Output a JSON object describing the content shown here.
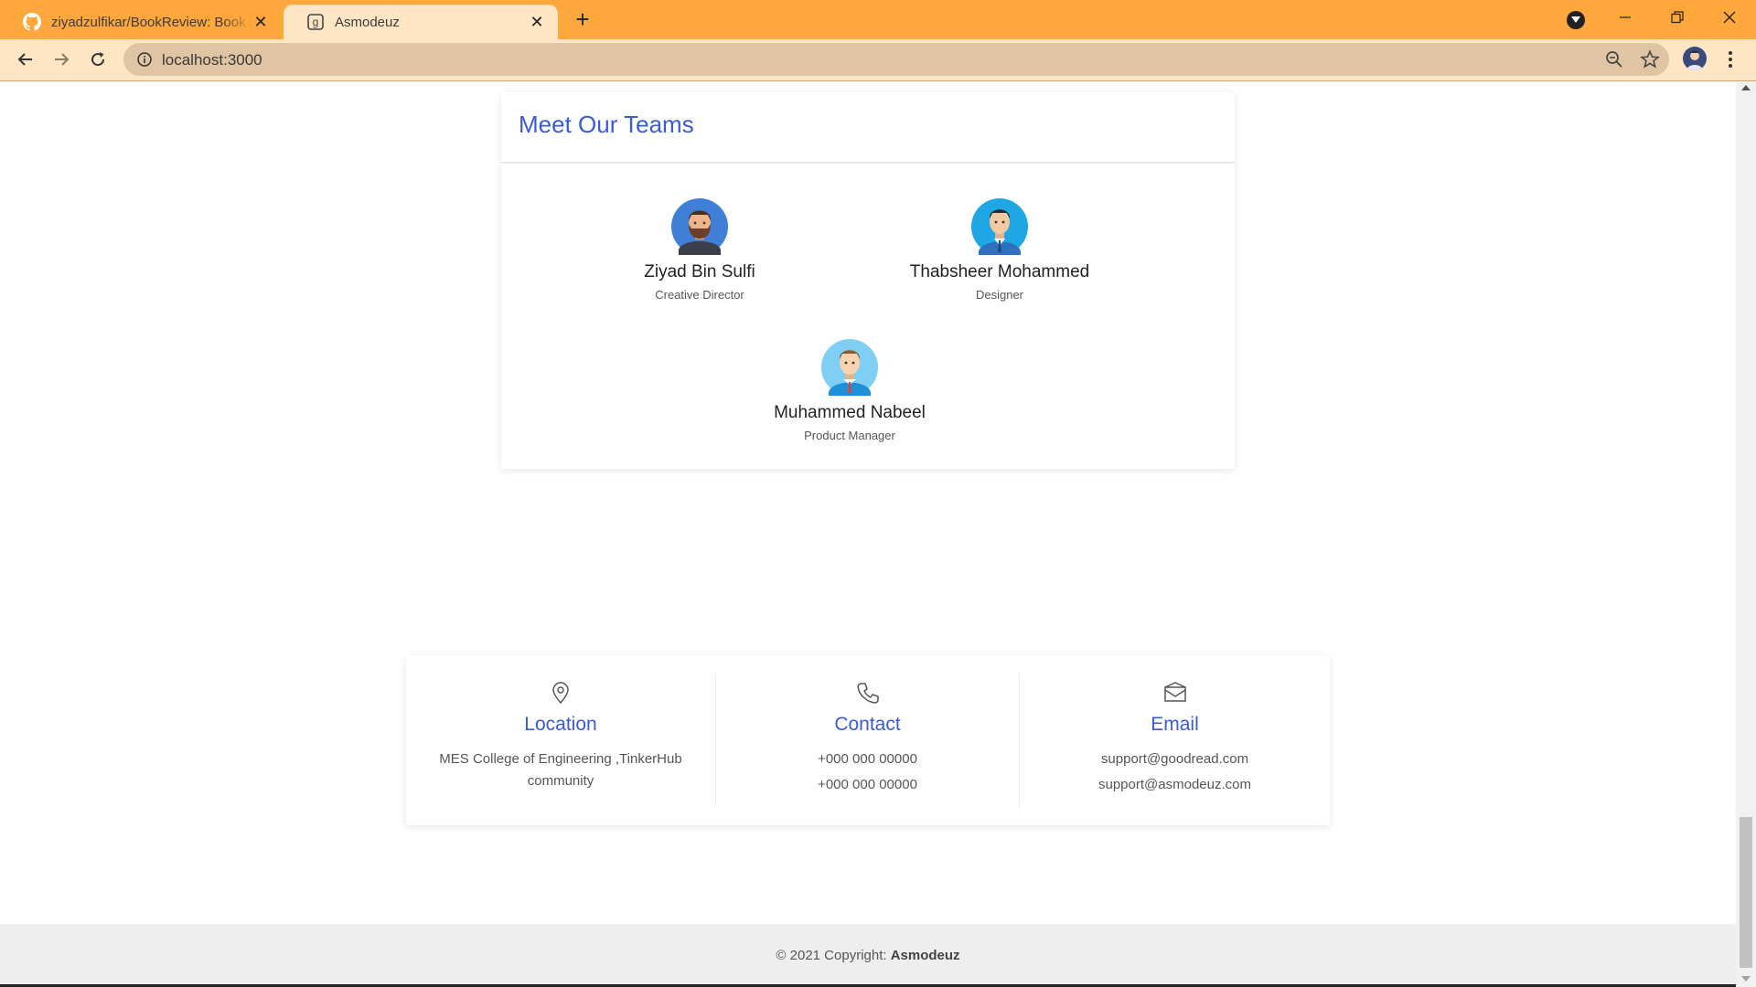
{
  "browser": {
    "tabs": [
      {
        "title": "ziyadzulfikar/BookReview: Book R",
        "favicon": "github-icon",
        "active": false
      },
      {
        "title": "Asmodeuz",
        "favicon": "goodreads-g-icon",
        "active": true
      }
    ],
    "url": "localhost:3000"
  },
  "team": {
    "title": "Meet Our Teams",
    "members": [
      {
        "name": "Ziyad Bin Sulfi",
        "role": "Creative Director",
        "avatar": "bearded-man-avatar"
      },
      {
        "name": "Thabsheer Mohammed",
        "role": "Designer",
        "avatar": "man-suit-avatar"
      },
      {
        "name": "Muhammed Nabeel",
        "role": "Product Manager",
        "avatar": "man-tie-avatar"
      }
    ]
  },
  "contact": {
    "location": {
      "heading": "Location",
      "icon": "map-pin-icon",
      "line1": "MES College of Engineering ,TinkerHub",
      "line2": "community"
    },
    "phone": {
      "heading": "Contact",
      "icon": "phone-icon",
      "line1": "+000 000 00000",
      "line2": "+000 000 00000"
    },
    "email": {
      "heading": "Email",
      "icon": "envelope-icon",
      "line1": "support@goodread.com",
      "line2": "support@asmodeuz.com"
    }
  },
  "footer": {
    "prefix": "© 2021 Copyright: ",
    "brand": "Asmodeuz"
  },
  "colors": {
    "accent": "#3a5bd9",
    "tabbar": "#fda73c",
    "toolbar": "#fee5c4"
  }
}
